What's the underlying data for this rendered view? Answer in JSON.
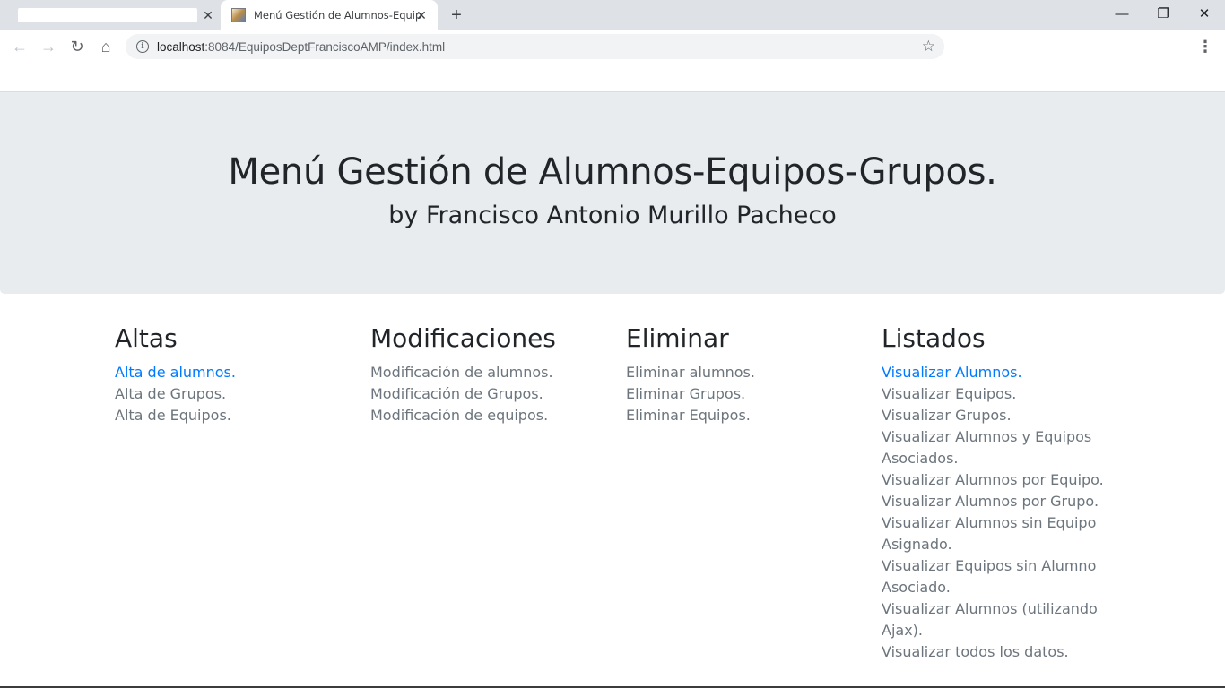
{
  "tabs": {
    "active_title": "Menú Gestión de Alumnos-Equipos-Grupos.",
    "close_glyph": "✕",
    "newtab_glyph": "+"
  },
  "window": {
    "minimize_glyph": "—",
    "maximize_glyph": "❐",
    "close_glyph": "✕"
  },
  "toolbar": {
    "back_glyph": "←",
    "forward_glyph": "→",
    "reload_glyph": "↻",
    "home_glyph": "⌂",
    "url_host": "localhost",
    "url_rest": ":8084/EquiposDeptFranciscoAMP/index.html",
    "star_glyph": "☆",
    "menu_glyph": "⋮"
  },
  "page": {
    "title": "Menú Gestión de Alumnos-Equipos-Grupos.",
    "subtitle": "by Francisco Antonio Murillo Pacheco",
    "sections": [
      {
        "heading": "Altas",
        "items": [
          "Alta de alumnos.",
          "Alta de Grupos.",
          "Alta de Equipos."
        ]
      },
      {
        "heading": "Modificaciones",
        "items": [
          "Modificación de alumnos.",
          "Modificación de Grupos.",
          "Modificación de equipos."
        ]
      },
      {
        "heading": "Eliminar",
        "items": [
          "Eliminar alumnos.",
          "Eliminar Grupos.",
          "Eliminar Equipos."
        ]
      },
      {
        "heading": "Listados",
        "items": [
          "Visualizar Alumnos.",
          "Visualizar Equipos.",
          "Visualizar Grupos.",
          "Visualizar Alumnos y Equipos Asociados.",
          "Visualizar Alumnos por Equipo.",
          "Visualizar Alumnos por Grupo.",
          "Visualizar Alumnos sin Equipo Asignado.",
          "Visualizar Equipos sin Alumno Asociado.",
          "Visualizar Alumnos (utilizando Ajax).",
          "Visualizar todos los datos."
        ]
      }
    ]
  },
  "colors": {
    "link": "#007bff",
    "muted": "#6c757d",
    "jumbotron_bg": "#e9ecef"
  }
}
